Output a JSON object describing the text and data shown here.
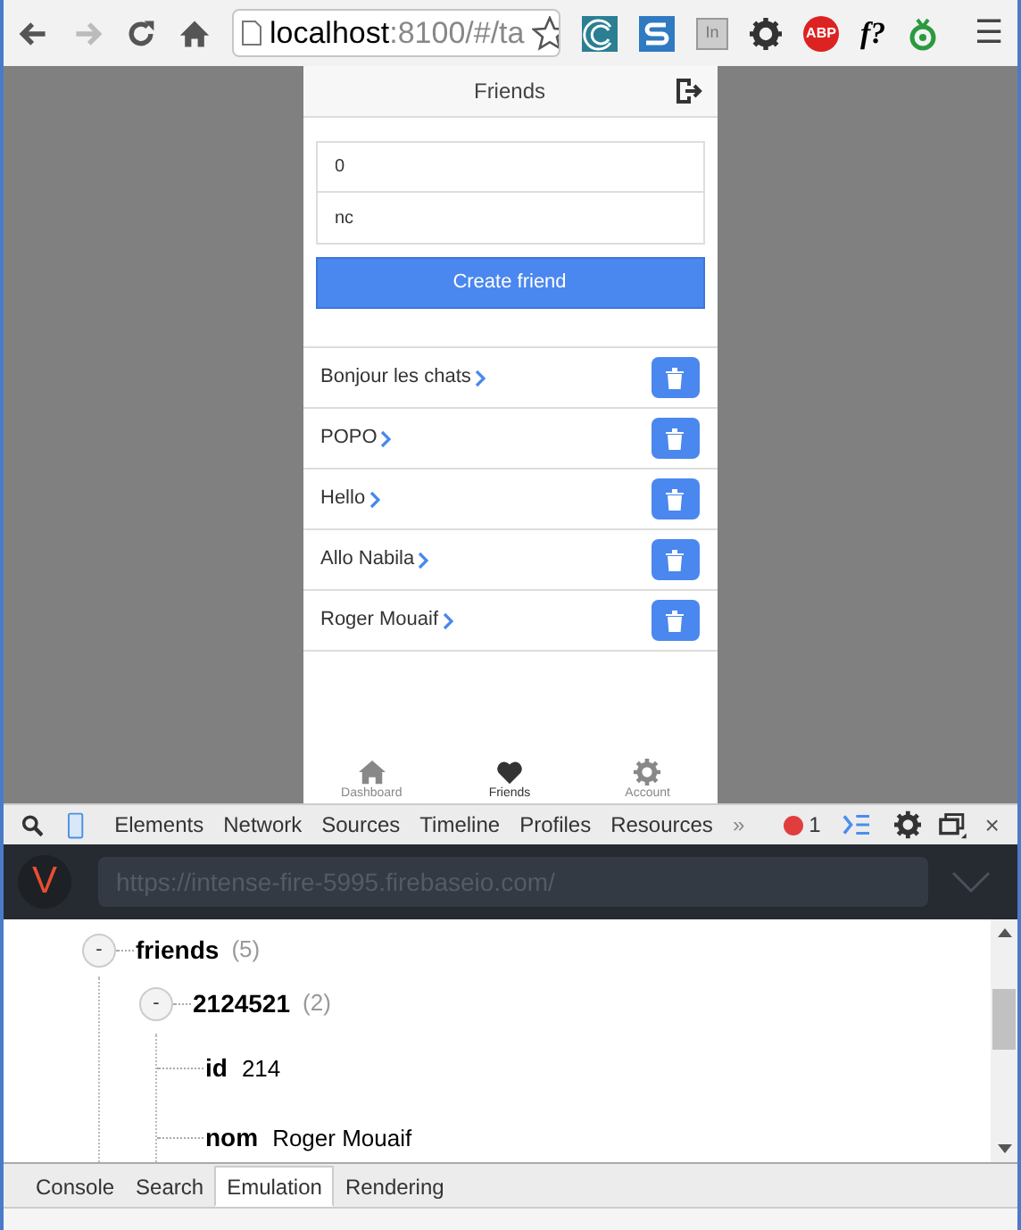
{
  "browser": {
    "url_host": "localhost",
    "url_rest": ":8100/#/ta",
    "menu_glyph": "☰",
    "abp_label": "ABP",
    "font_ext_label": "f?",
    "linkedin_label": "In"
  },
  "app": {
    "title": "Friends",
    "inputs": [
      {
        "value": "0"
      },
      {
        "value": "nc"
      }
    ],
    "create_button": "Create friend",
    "friends": [
      {
        "name": "Bonjour les chats"
      },
      {
        "name": "POPO"
      },
      {
        "name": "Hello"
      },
      {
        "name": "Allo Nabila"
      },
      {
        "name": "Roger Mouaif"
      }
    ],
    "tabs": [
      {
        "label": "Dashboard",
        "selected": false
      },
      {
        "label": "Friends",
        "selected": true
      },
      {
        "label": "Account",
        "selected": false
      }
    ]
  },
  "devtools": {
    "tabs": [
      "Elements",
      "Network",
      "Sources",
      "Timeline",
      "Profiles",
      "Resources"
    ],
    "more": "»",
    "error_count": "1",
    "close_glyph": "×",
    "vulcan": {
      "logo": "V",
      "url": "https://intense-fire-5995.firebaseio.com/"
    },
    "tree": [
      {
        "key": "friends",
        "count": "(5)",
        "toggle": "-",
        "expanded": true,
        "children": [
          {
            "key": "2124521",
            "count": "(2)",
            "toggle": "-",
            "expanded": true,
            "children": [
              {
                "key": "id",
                "value": "214"
              },
              {
                "key": "nom",
                "value": "Roger Mouaif"
              }
            ]
          }
        ]
      }
    ],
    "drawer_tabs": [
      {
        "label": "Console",
        "selected": false
      },
      {
        "label": "Search",
        "selected": false
      },
      {
        "label": "Emulation",
        "selected": true
      },
      {
        "label": "Rendering",
        "selected": false
      }
    ]
  }
}
